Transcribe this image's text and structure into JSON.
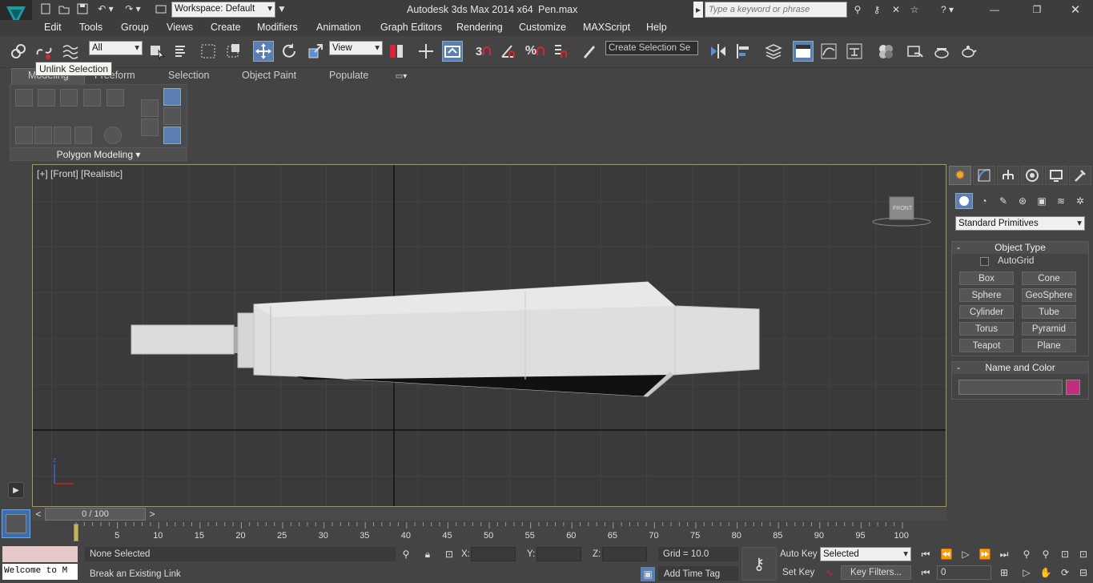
{
  "app": {
    "title": "Autodesk 3ds Max  2014 x64",
    "file": "Pen.max",
    "workspace": "Workspace: Default",
    "search_placeholder": "Type a keyword or phrase"
  },
  "menu": [
    "Edit",
    "Tools",
    "Group",
    "Views",
    "Create",
    "Modifiers",
    "Animation",
    "Graph Editors",
    "Rendering",
    "Customize",
    "MAXScript",
    "Help"
  ],
  "toolbar": {
    "filter": "All",
    "ref_coord": "View",
    "named_selection": "Create Selection Se",
    "tooltip": "Unlink Selection",
    "snap_label": "3"
  },
  "ribbon": {
    "tabs": [
      "Modeling",
      "Freeform",
      "Selection",
      "Object Paint",
      "Populate"
    ],
    "panel_label": "Polygon Modeling"
  },
  "viewport": {
    "label": "[+] [Front] [Realistic]",
    "viewcube_label": "FRONT",
    "axis_z": "z"
  },
  "command_panel": {
    "dropdown": "Standard Primitives",
    "object_type_title": "Object Type",
    "autogrid": "AutoGrid",
    "buttons": [
      "Box",
      "Cone",
      "Sphere",
      "GeoSphere",
      "Cylinder",
      "Tube",
      "Torus",
      "Pyramid",
      "Teapot",
      "Plane"
    ],
    "name_color_title": "Name and Color",
    "color": "#c0307a",
    "rollout_toggle": "-"
  },
  "timeline": {
    "frame": "0 / 100",
    "ticks": [
      "5",
      "10",
      "15",
      "20",
      "25",
      "30",
      "35",
      "40",
      "45",
      "50",
      "55",
      "60",
      "65",
      "70",
      "75",
      "80",
      "85",
      "90",
      "95",
      "100"
    ]
  },
  "status": {
    "selection": "None Selected",
    "prompt": "Break an Existing Link",
    "listener": "Welcome to M",
    "x_label": "X:",
    "y_label": "Y:",
    "z_label": "Z:",
    "grid": "Grid = 10.0",
    "auto_key": "Auto Key",
    "set_key": "Set Key",
    "key_mode": "Selected",
    "key_filters": "Key Filters...",
    "add_time_tag": "Add Time Tag",
    "current_frame": "0"
  }
}
